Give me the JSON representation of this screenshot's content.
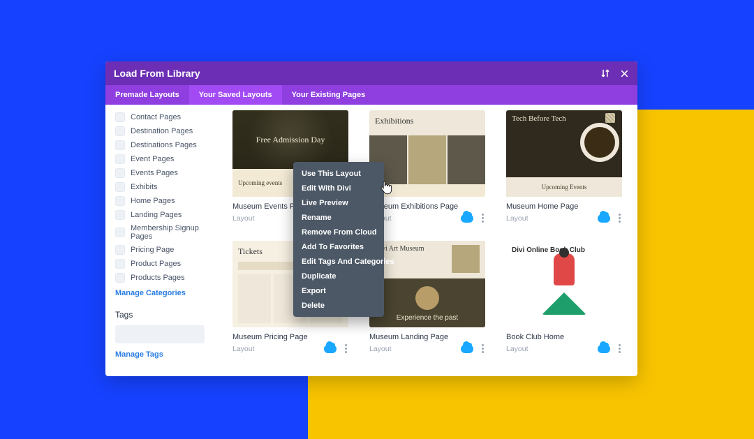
{
  "modal": {
    "title": "Load From Library",
    "tabs": {
      "premade": "Premade Layouts",
      "saved": "Your Saved Layouts",
      "existing": "Your Existing Pages",
      "activeIndex": 1
    }
  },
  "sidebar": {
    "categories": [
      "Contact Pages",
      "Destination Pages",
      "Destinations Pages",
      "Event Pages",
      "Events Pages",
      "Exhibits",
      "Home Pages",
      "Landing Pages",
      "Membership Signup Pages",
      "Pricing Page",
      "Product Pages",
      "Products Pages"
    ],
    "manage_categories": "Manage Categories",
    "tags_heading": "Tags",
    "manage_tags": "Manage Tags"
  },
  "cards": [
    {
      "title": "Museum Events Page",
      "meta": "Layout"
    },
    {
      "title": "Museum Exhibitions Page",
      "meta": "Layout"
    },
    {
      "title": "Museum Home Page",
      "meta": "Layout"
    },
    {
      "title": "Museum Pricing Page",
      "meta": "Layout"
    },
    {
      "title": "Museum Landing Page",
      "meta": "Layout"
    },
    {
      "title": "Book Club Home",
      "meta": "Layout"
    }
  ],
  "thumbs": {
    "events_hero": "Free Admission Day",
    "events_strip": "Upcoming events",
    "exhibitions_title": "Exhibitions",
    "home_title": "Tech Before Tech",
    "home_strip": "Upcoming Events",
    "pricing_title": "Tickets",
    "landing_top": "Divi Art Museum",
    "landing_bottom": "Experience the past",
    "book_title": "Divi Online Book Club"
  },
  "context_menu": {
    "items": [
      "Use This Layout",
      "Edit With Divi",
      "Live Preview",
      "Rename",
      "Remove From Cloud",
      "Add To Favorites",
      "Edit Tags And Categories",
      "Duplicate",
      "Export",
      "Delete"
    ]
  }
}
